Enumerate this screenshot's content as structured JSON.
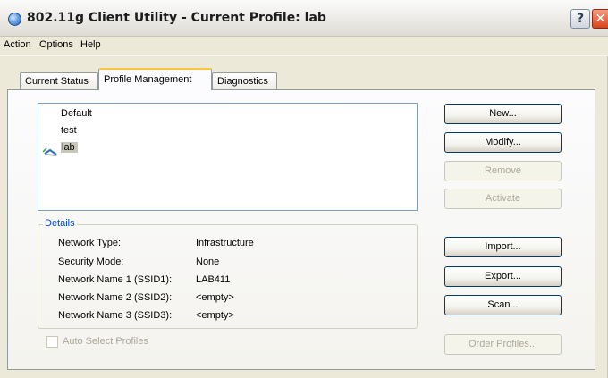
{
  "window": {
    "title": "802.11g Client Utility - Current Profile: lab",
    "help_glyph": "?",
    "close_glyph": "✕"
  },
  "menu": {
    "items": [
      {
        "label": "Action"
      },
      {
        "label": "Options"
      },
      {
        "label": "Help"
      }
    ]
  },
  "tabs": [
    {
      "label": "Current Status",
      "active": false
    },
    {
      "label": "Profile Management",
      "active": true
    },
    {
      "label": "Diagnostics",
      "active": false
    }
  ],
  "profiles": {
    "items": [
      {
        "label": "Default",
        "selected": false,
        "active": false
      },
      {
        "label": "test",
        "selected": false,
        "active": false
      },
      {
        "label": "lab",
        "selected": true,
        "active": true
      }
    ]
  },
  "buttons": {
    "new": "New...",
    "modify": "Modify...",
    "remove": "Remove",
    "activate": "Activate",
    "import": "Import...",
    "export": "Export...",
    "scan": "Scan...",
    "order_profiles": "Order Profiles..."
  },
  "details": {
    "legend": "Details",
    "rows": [
      {
        "label": "Network Type:",
        "value": "Infrastructure"
      },
      {
        "label": "Security Mode:",
        "value": "None"
      },
      {
        "label": "Network Name 1 (SSID1):",
        "value": "LAB411"
      },
      {
        "label": "Network Name 2 (SSID2):",
        "value": "<empty>"
      },
      {
        "label": "Network Name 3 (SSID3):",
        "value": "<empty>"
      }
    ]
  },
  "auto_select": {
    "label": "Auto Select Profiles",
    "checked": false,
    "enabled": false
  },
  "colors": {
    "tab_highlight": "#ffc83c",
    "selection": "#c9c7ba",
    "group_legend": "#0046d5",
    "disabled_text": "#aca899"
  }
}
